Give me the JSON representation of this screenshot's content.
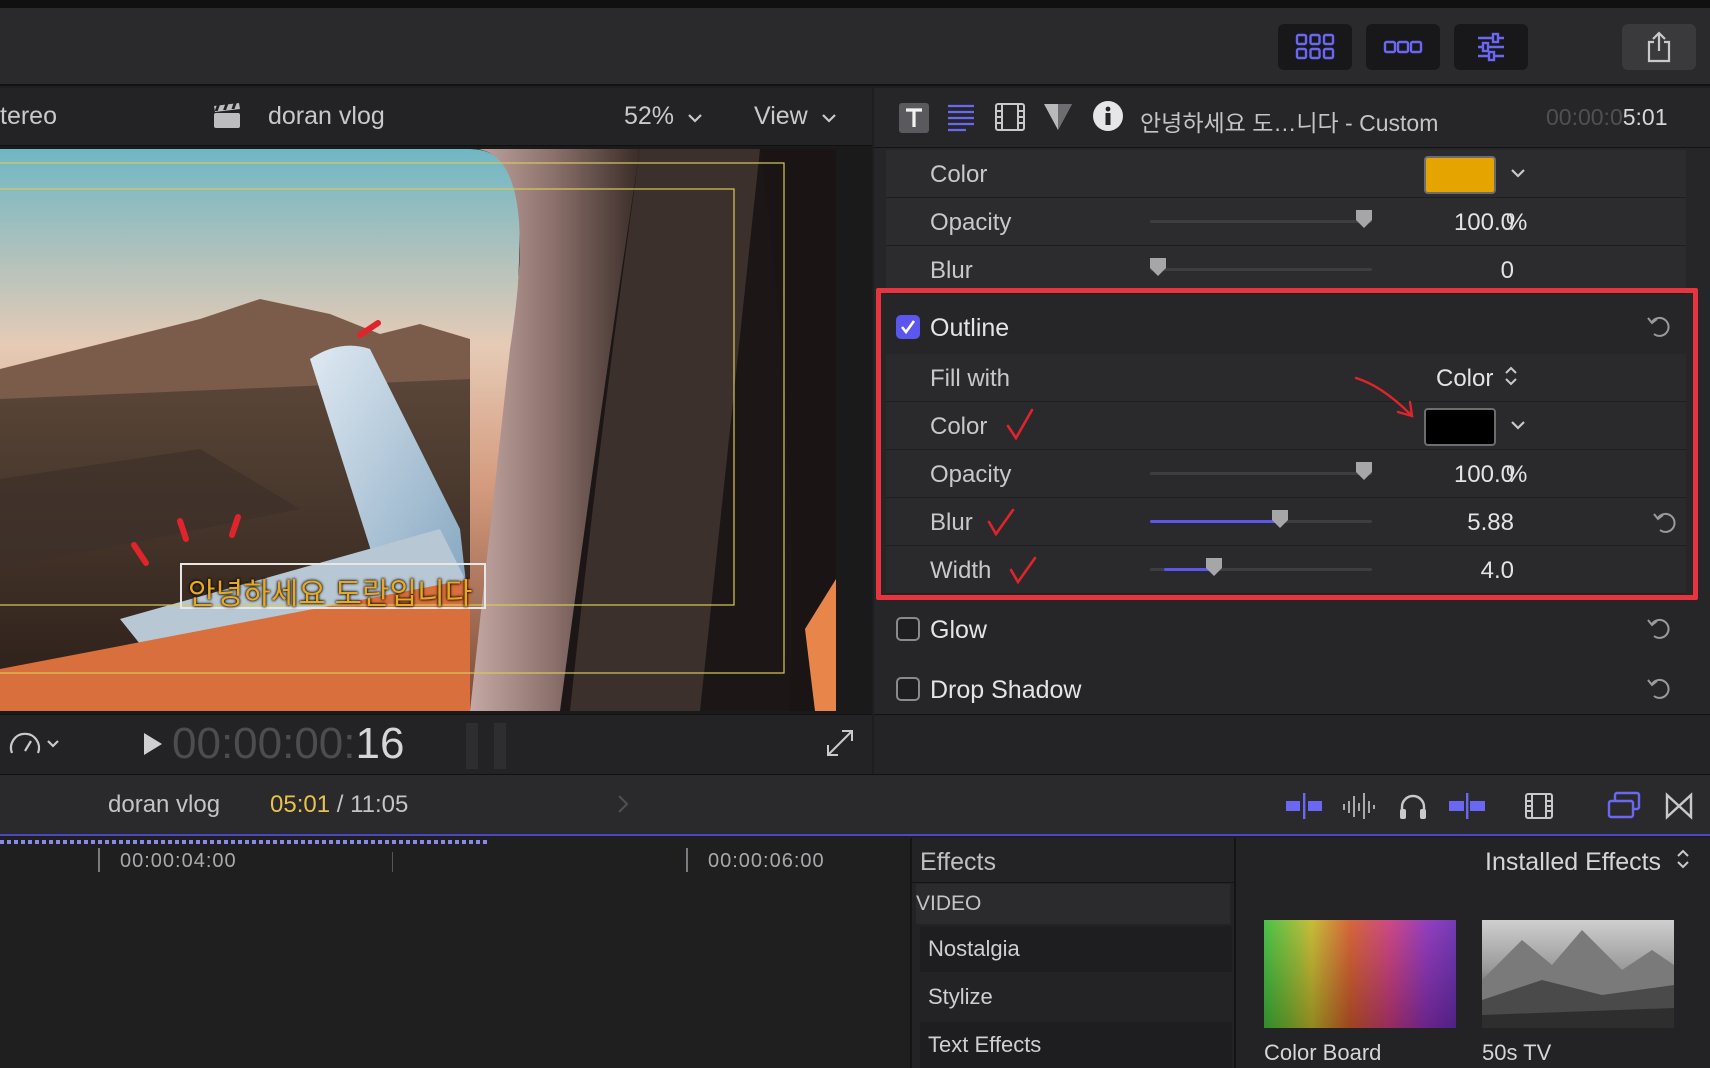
{
  "viewer": {
    "audio_label": "tereo",
    "project_name": "doran vlog",
    "zoom": "52%",
    "view_label": "View",
    "subtitle": "안녕하세요 도란입니다",
    "timecode_dim": "00:00:00:",
    "timecode_frames": "16"
  },
  "inspector": {
    "title": "안녕하세요 도…니다 - Custom",
    "timecode_dim": "00:00:0",
    "timecode_bright": "5:01",
    "face": {
      "color_label": "Color",
      "color_value": "#e5a400",
      "opacity_label": "Opacity",
      "opacity_value": "100.0",
      "blur_label": "Blur",
      "blur_value": "0"
    },
    "outline": {
      "section_label": "Outline",
      "enabled": true,
      "fill_with_label": "Fill with",
      "fill_with_value": "Color",
      "color_label": "Color",
      "color_value": "#000000",
      "opacity_label": "Opacity",
      "opacity_value": "100.0",
      "blur_label": "Blur",
      "blur_value": "5.88",
      "width_label": "Width",
      "width_value": "4.0"
    },
    "percent_unit": "%",
    "glow_label": "Glow",
    "drop_shadow_label": "Drop Shadow"
  },
  "timeline": {
    "project_name": "doran vlog",
    "position": "05:01",
    "separator": " / ",
    "duration": "11:05",
    "ruler": [
      "00:00:04:00",
      "00:00:06:00"
    ]
  },
  "effects": {
    "header": "Effects",
    "category": "VIDEO",
    "items": [
      "Nostalgia",
      "Stylize",
      "Text Effects"
    ],
    "source": "Installed Effects",
    "thumbnails": [
      "Color Board",
      "50s TV"
    ]
  },
  "colors": {
    "accent": "#5b57ee",
    "highlight": "#e8343f",
    "timecode": "#e8c24a"
  }
}
